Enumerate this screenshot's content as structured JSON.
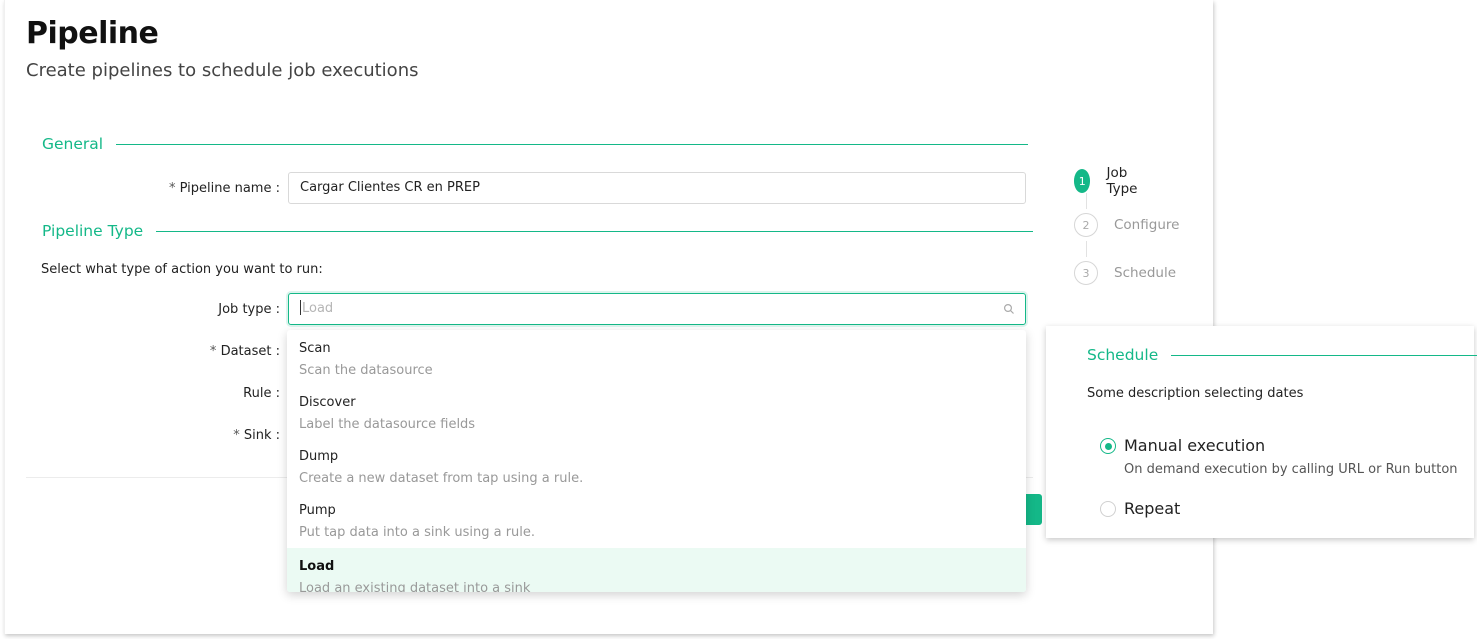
{
  "header": {
    "title": "Pipeline",
    "subtitle": "Create pipelines to schedule job executions"
  },
  "general": {
    "section_title": "General",
    "pipeline_name_label": "Pipeline name",
    "pipeline_name_value": "Cargar Clientes CR en PREP"
  },
  "pipeline_type": {
    "section_title": "Pipeline Type",
    "instruction": "Select what type of action you want to run:",
    "job_type_label": "Job type",
    "job_type_placeholder": "Load",
    "dataset_label": "Dataset",
    "rule_label": "Rule",
    "sink_label": "Sink"
  },
  "dropdown": {
    "options": [
      {
        "title": "Scan",
        "description": "Scan the datasource"
      },
      {
        "title": "Discover",
        "description": "Label the datasource fields"
      },
      {
        "title": "Dump",
        "description": "Create a new dataset from tap using a rule."
      },
      {
        "title": "Pump",
        "description": "Put tap data into a sink using a rule."
      },
      {
        "title": "Load",
        "description": "Load an existing dataset into a sink"
      }
    ],
    "selected": "Load"
  },
  "steps": [
    {
      "number": "1",
      "label": "Job Type",
      "state": "active"
    },
    {
      "number": "2",
      "label": "Configure",
      "state": "idle"
    },
    {
      "number": "3",
      "label": "Schedule",
      "state": "idle"
    }
  ],
  "schedule": {
    "section_title": "Schedule",
    "description": "Some description selecting dates",
    "options": [
      {
        "label": "Manual execution",
        "help": "On demand execution by calling URL or Run button",
        "checked": true
      },
      {
        "label": "Repeat",
        "checked": false
      }
    ]
  },
  "colors": {
    "accent": "#14b888",
    "selected_row": "#ebfaf3"
  }
}
